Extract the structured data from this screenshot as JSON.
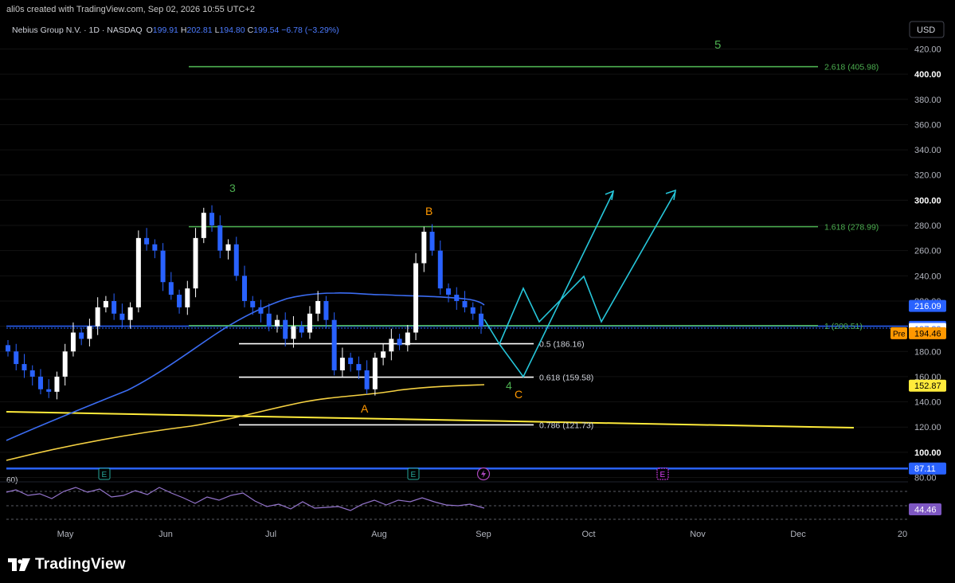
{
  "credit": "ali0s created with TradingView.com, Sep 02, 2026 10:55 UTC+2",
  "brand": "TradingView",
  "currency": "USD",
  "legend": {
    "symbol": "Nebius Group N.V. · 1D · NASDAQ",
    "o_label": "O",
    "o": "199.91",
    "h_label": "H",
    "h": "202.81",
    "l_label": "L",
    "l": "194.80",
    "c_label": "C",
    "c": "199.54",
    "chg": "−6.78 (−3.29%)"
  },
  "price_axis": [
    "420.00",
    "400.00",
    "380.00",
    "360.00",
    "340.00",
    "320.00",
    "300.00",
    "280.00",
    "260.00",
    "240.00",
    "220.00",
    "200.00",
    "180.00",
    "160.00",
    "140.00",
    "120.00",
    "100.00",
    "80.00"
  ],
  "price_tags": [
    {
      "value": "216.09",
      "price": 216.09,
      "bg": "#2962ff",
      "fg": "#ffffff"
    },
    {
      "value": "199.54",
      "price": 199.54,
      "bg": "#2962ff",
      "fg": "#ffffff"
    },
    {
      "value": "197.89",
      "price": 197.89,
      "bg": "#ffffff",
      "fg": "#2962ff"
    },
    {
      "value": "194.46",
      "price": 194.46,
      "bg": "#ff9800",
      "fg": "#000000",
      "pre": "Pre"
    },
    {
      "value": "152.87",
      "price": 152.87,
      "bg": "#ffeb3b",
      "fg": "#000000"
    },
    {
      "value": "87.11",
      "price": 87.11,
      "bg": "#2962ff",
      "fg": "#ffffff"
    }
  ],
  "time_axis": [
    "May",
    "Jun",
    "Jul",
    "Aug",
    "Sep",
    "Oct",
    "Nov",
    "Dec",
    "20"
  ],
  "fib_levels": [
    {
      "label": "2.618 (405.98)",
      "price": 405.98,
      "color": "#4caf50"
    },
    {
      "label": "1.618 (278.99)",
      "price": 278.99,
      "color": "#4caf50"
    },
    {
      "label": "1 (200.51)",
      "price": 200.51,
      "color": "#4caf50"
    },
    {
      "label": "0.5 (186.16)",
      "price": 186.16,
      "color": "#ffffff"
    },
    {
      "label": "0.618 (159.58)",
      "price": 159.58,
      "color": "#ffffff"
    },
    {
      "label": "0.786 (121.73)",
      "price": 121.73,
      "color": "#ffffff"
    }
  ],
  "wave_labels": [
    {
      "text": "3",
      "color": "#4caf50"
    },
    {
      "text": "B",
      "color": "#ff9800"
    },
    {
      "text": "A",
      "color": "#ff9800"
    },
    {
      "text": "4",
      "color": "#4caf50"
    },
    {
      "text": "C",
      "color": "#ff9800"
    },
    {
      "text": "5",
      "color": "#4caf50"
    }
  ],
  "rsi": {
    "period_label": "60)",
    "value": "44.46"
  },
  "chart_data": {
    "type": "candlestick",
    "symbol": "Nebius Group N.V.",
    "interval": "1D",
    "exchange": "NASDAQ",
    "ylim": [
      70,
      430
    ],
    "series": [
      {
        "name": "candles",
        "approx_closes": [
          180,
          170,
          165,
          160,
          150,
          148,
          160,
          180,
          195,
          190,
          200,
          215,
          220,
          210,
          205,
          215,
          270,
          265,
          260,
          235,
          225,
          215,
          230,
          270,
          290,
          280,
          260,
          265,
          240,
          220,
          215,
          210,
          200,
          205,
          190,
          200,
          195,
          210,
          220,
          205,
          165,
          175,
          170,
          165,
          150,
          175,
          180,
          190,
          185,
          195,
          250,
          275,
          260,
          230,
          225,
          220,
          215,
          210,
          200
        ]
      },
      {
        "name": "blue moving average",
        "approx_values": [
          105,
          120,
          140,
          160,
          175,
          190,
          205,
          220,
          230,
          232,
          228,
          226,
          224,
          223,
          225,
          222,
          220,
          218,
          216
        ]
      },
      {
        "name": "yellow moving average",
        "approx_values": [
          78,
          90,
          100,
          108,
          118,
          128,
          135,
          140,
          145,
          150,
          152.87
        ]
      },
      {
        "name": "yellow trendline",
        "approx_values": [
          132,
          119
        ]
      },
      {
        "name": "RSI",
        "last": 44.46
      }
    ]
  }
}
